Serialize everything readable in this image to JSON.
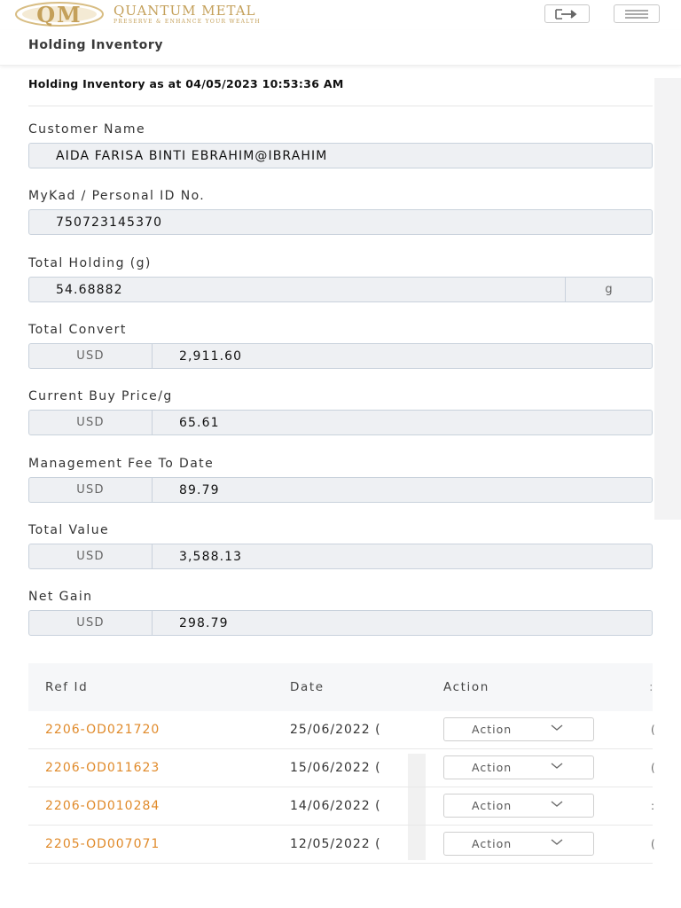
{
  "header": {
    "logo_initials": "QM",
    "brand_name": "QUANTUM METAL",
    "tagline": "PRESERVE & ENHANCE YOUR WEALTH",
    "logout_icon": "logout-icon",
    "menu_icon": "hamburger-menu-icon",
    "brand_color": "#c4a05a"
  },
  "page": {
    "title": "Holding Inventory",
    "subtitle": "Holding Inventory as at 04/05/2023 10:53:36 AM"
  },
  "fields": {
    "customer_name": {
      "label": "Customer Name",
      "value": "AIDA FARISA BINTI EBRAHIM@IBRAHIM"
    },
    "mykad": {
      "label": "MyKad / Personal ID No.",
      "value": "750723145370"
    },
    "total_holding": {
      "label": "Total Holding (g)",
      "value": "54.68882",
      "suffix": "g"
    },
    "total_convert": {
      "label": "Total Convert",
      "currency": "USD",
      "value": "2,911.60"
    },
    "current_buy_price": {
      "label": "Current Buy Price/g",
      "currency": "USD",
      "value": "65.61"
    },
    "management_fee": {
      "label": "Management Fee To Date",
      "currency": "USD",
      "value": "89.79"
    },
    "total_value": {
      "label": "Total Value",
      "currency": "USD",
      "value": "3,588.13"
    },
    "net_gain": {
      "label": "Net Gain",
      "currency": "USD",
      "value": "298.79"
    }
  },
  "table": {
    "headers": {
      "ref_id": "Ref Id",
      "date": "Date",
      "action": "Action"
    },
    "rows": [
      {
        "ref_id": "2206-OD021720",
        "date": "25/06/2022 (",
        "action": "Action",
        "cut": "("
      },
      {
        "ref_id": "2206-OD011623",
        "date": "15/06/2022 (",
        "action": "Action",
        "cut": "("
      },
      {
        "ref_id": "2206-OD010284",
        "date": "14/06/2022 (",
        "action": "Action",
        "cut": ":"
      },
      {
        "ref_id": "2205-OD007071",
        "date": "12/05/2022 (",
        "action": "Action",
        "cut": "("
      }
    ],
    "link_color": "#e08a2a"
  }
}
